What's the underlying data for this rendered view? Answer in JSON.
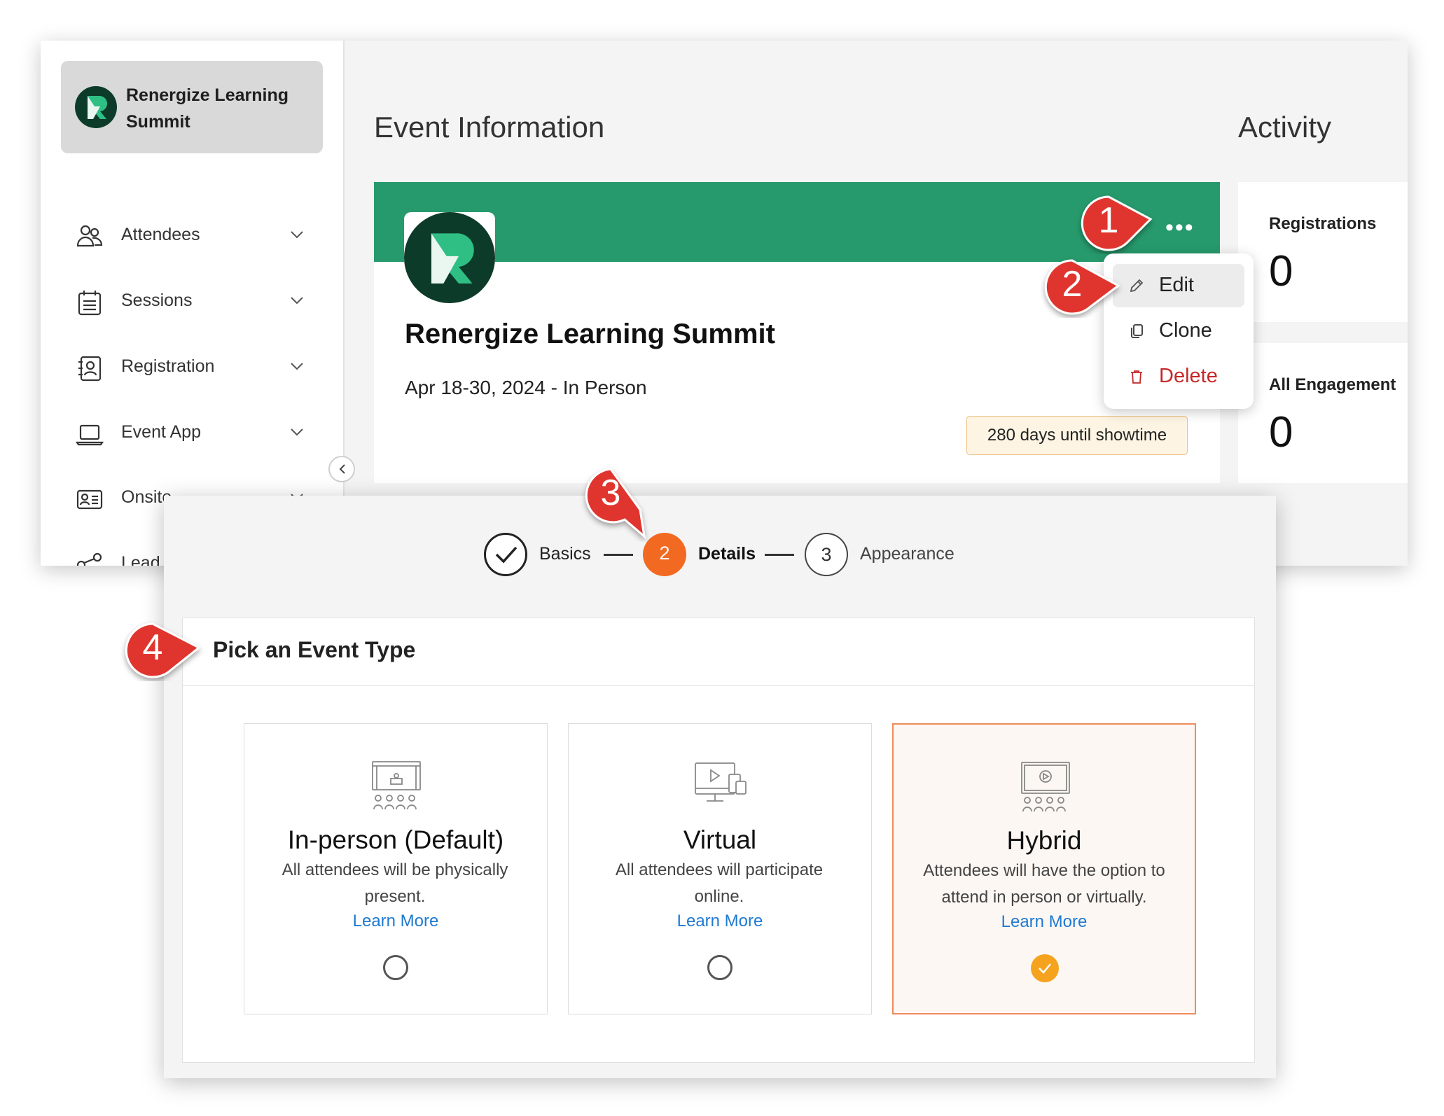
{
  "sidebar": {
    "event_name": "Renergize Learning Summit",
    "items": [
      {
        "label": "Attendees",
        "icon": "people-icon"
      },
      {
        "label": "Sessions",
        "icon": "agenda-icon"
      },
      {
        "label": "Registration",
        "icon": "contact-book-icon"
      },
      {
        "label": "Event App",
        "icon": "laptop-icon"
      },
      {
        "label": "Onsite",
        "icon": "badge-card-icon"
      },
      {
        "label": "Lead",
        "icon": "share-icon"
      }
    ]
  },
  "main": {
    "section_title": "Event Information",
    "event": {
      "title": "Renergize Learning Summit",
      "dates": "Apr 18-30, 2024 - In Person",
      "countdown": "280 days until showtime",
      "more_glyph": "•••"
    }
  },
  "activity": {
    "title": "Activity",
    "stats": [
      {
        "label": "Registrations",
        "value": "0"
      },
      {
        "label": "All Engagement",
        "value": "0"
      }
    ]
  },
  "context_menu": {
    "items": [
      {
        "label": "Edit",
        "icon": "pencil-icon"
      },
      {
        "label": "Clone",
        "icon": "clone-icon"
      },
      {
        "label": "Delete",
        "icon": "trash-icon"
      }
    ]
  },
  "wizard": {
    "steps": [
      {
        "number": "1",
        "label": "Basics",
        "state": "completed"
      },
      {
        "number": "2",
        "label": "Details",
        "state": "current"
      },
      {
        "number": "3",
        "label": "Appearance",
        "state": "upcoming"
      }
    ],
    "section_heading": "Pick an Event Type",
    "event_types": [
      {
        "name": "In-person (Default)",
        "description": "All attendees will be physically present.",
        "link": "Learn More",
        "selected": false,
        "icon": "stage-audience-icon"
      },
      {
        "name": "Virtual",
        "description": "All attendees will participate online.",
        "link": "Learn More",
        "selected": false,
        "icon": "monitor-devices-icon"
      },
      {
        "name": "Hybrid",
        "description": "Attendees will have the option to attend in person or virtually.",
        "link": "Learn More",
        "selected": true,
        "icon": "screen-audience-icon"
      }
    ]
  },
  "callouts": [
    "1",
    "2",
    "3",
    "4"
  ],
  "colors": {
    "brand_green": "#269a6c",
    "accent_orange": "#f26a22",
    "callout_red": "#e0342f",
    "selected_check": "#f5a21e",
    "link_blue": "#1f7ad1",
    "delete_red": "#c62828"
  }
}
